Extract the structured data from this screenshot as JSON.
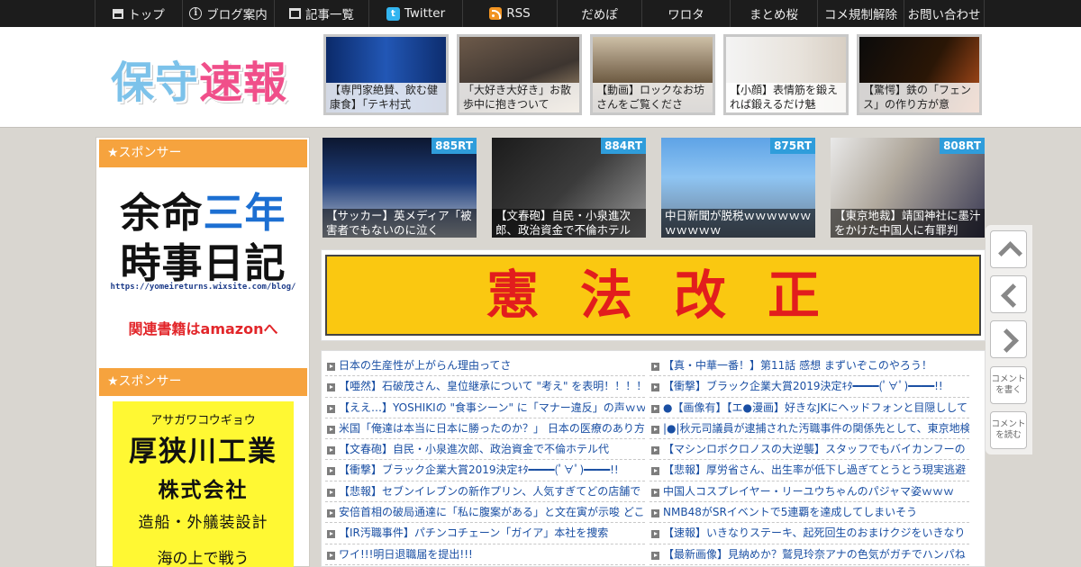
{
  "nav": [
    {
      "label": "トップ",
      "icon": "home-icon"
    },
    {
      "label": "ブログ案内",
      "icon": "info-icon"
    },
    {
      "label": "記事一覧",
      "icon": "list-icon"
    },
    {
      "label": "Twitter",
      "icon": "twitter-icon"
    },
    {
      "label": "RSS",
      "icon": "rss-icon"
    },
    {
      "label": "だめぽ"
    },
    {
      "label": "ワロタ"
    },
    {
      "label": "まとめ桜"
    },
    {
      "label": "コメ規制解除"
    },
    {
      "label": "お問い合わせ"
    }
  ],
  "header": {
    "logo_part1": "保守",
    "logo_part2": "速報",
    "featured": [
      {
        "caption": "【専門家絶賛、飲む健康食】「テキ村式"
      },
      {
        "caption": "「大好き大好き」お散歩中に抱きついて"
      },
      {
        "caption": "【動画】ロックなお坊さんをご覧くださ"
      },
      {
        "caption": "【小顔】表情筋を鍛えれば鍛えるだけ魅"
      },
      {
        "caption": "【驚愕】鉄の「フェンス」の作り方が意"
      }
    ]
  },
  "sidebar": {
    "sponsor_heading_1": "★スポンサー",
    "ad1": {
      "line1_a": "余命",
      "line1_b": "三年",
      "line2": "時事日記",
      "url": "https://yomeireturns.wixsite.com/blog/",
      "amazon": "関連書籍はamazonへ"
    },
    "sponsor_heading_2": "★スポンサー",
    "ad2": {
      "kana": "アサガワコウギョウ",
      "company": "厚狭川工業",
      "kk": "株式会社",
      "service": "造船・外艤装設計",
      "more": "海の上で戦う"
    }
  },
  "ranking": [
    {
      "rt": "885RT",
      "caption": "【サッカー】英メディア「被害者でもないのに泣く"
    },
    {
      "rt": "884RT",
      "caption": "【文春砲】自民・小泉進次郎、政治資金で不倫ホテル"
    },
    {
      "rt": "875RT",
      "caption": "中日新聞が脱税ｗｗｗｗｗｗｗｗｗｗｗ"
    },
    {
      "rt": "808RT",
      "caption": "【東京地裁】靖国神社に墨汁をかけた中国人に有罪判"
    }
  ],
  "banner": {
    "text": "憲法改正"
  },
  "articles_left": [
    "日本の生産性が上がらん理由ってさ",
    "【唖然】石破茂さん、皇位継承について \"考え\" を表明！！！！",
    "【ええ…】YOSHIKIの \"食事シーン\" に「マナー違反」の声ｗｗｗ",
    "米国「俺達は本当に日本に勝ったのか？」 日本の医療のあり方",
    "【文春砲】自民・小泉進次郎、政治資金で不倫ホテル代",
    "【衝撃】ブラック企業大賞2019決定ｷﾀ━━━━(ﾟ∀ﾟ)━━━━!!",
    "【悲報】セブンイレブンの新作プリン、人気すぎてどの店舗で",
    "安倍首相の破局通達に「私に腹案がある」と文在寅が示唆 どこ",
    "【IR汚職事件】パチンコチェーン「ガイア」本社を捜索",
    "ワイ!!!明日退職届を提出!!!"
  ],
  "articles_right": [
    "【真・中華一番！】第11話 感想 まずいぞこのやろう！",
    "【衝撃】ブラック企業大賞2019決定ｷﾀ━━━━(ﾟ∀ﾟ)━━━━!!",
    "●【画像有】【エ●漫画】好きなJKにヘッドフォンと目隠しして",
    "|●|秋元司議員が逮捕された汚職事件の関係先として、東京地検",
    "【マシンロボクロノスの大逆襲】スタッフでもバイカンフーの",
    "【悲報】厚労省さん、出生率が低下し過ぎてとうとう現実逃避",
    "中国人コスプレイヤー・リーユウちゃんのパジャマ姿ｗｗｗ",
    "NMB48がSRイベントで5連覇を達成してしまいそう",
    "【速報】いきなりステーキ、起死回生のおまけクジをいきなり",
    "【最新画像】見納めか？鷲見玲奈アナの色気がガチでハンパね"
  ],
  "float_buttons": {
    "comment_write": "コメントを書く",
    "comment_read": "コメントを読む"
  }
}
